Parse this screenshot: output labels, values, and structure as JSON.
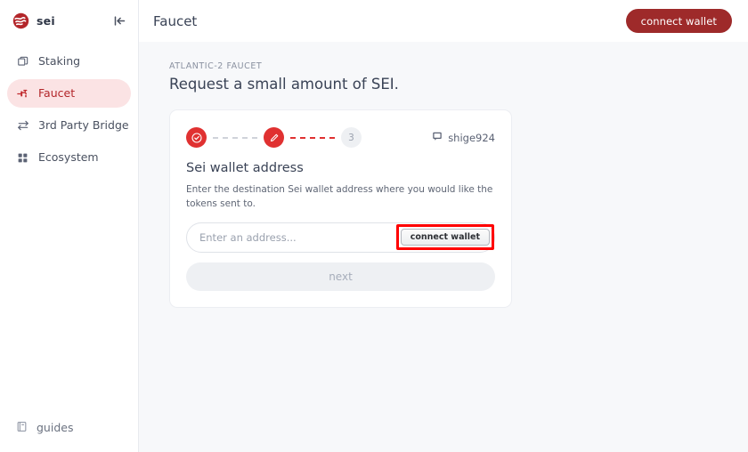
{
  "sidebar": {
    "brand": {
      "name": "sei",
      "logo_icon": "sei-logo-icon"
    },
    "collapse_icon": "collapse-panel-icon",
    "items": [
      {
        "label": "Staking",
        "icon": "layers-icon",
        "active": false
      },
      {
        "label": "Faucet",
        "icon": "faucet-tap-icon",
        "active": true
      },
      {
        "label": "3rd Party Bridge",
        "icon": "bridge-arrows-icon",
        "active": false
      },
      {
        "label": "Ecosystem",
        "icon": "grid-dots-icon",
        "active": false
      }
    ],
    "footer": {
      "label": "guides",
      "icon": "book-icon"
    }
  },
  "header": {
    "title": "Faucet",
    "connect_wallet_label": "connect wallet"
  },
  "main": {
    "eyebrow": "ATLANTIC-2 FAUCET",
    "headline": "Request a small amount of SEI.",
    "card": {
      "stepper": {
        "steps": [
          {
            "state": "done",
            "label": "",
            "icon": "check-circle-icon"
          },
          {
            "state": "active",
            "label": "",
            "icon": "pencil-edit-icon"
          },
          {
            "state": "todo",
            "label": "3",
            "icon": ""
          }
        ],
        "connectors": [
          "gray",
          "red"
        ]
      },
      "user": {
        "name": "shige924",
        "icon": "discord-chat-icon"
      },
      "title": "Sei wallet address",
      "description": "Enter the destination Sei wallet address where you would like the tokens sent to.",
      "address_input": {
        "placeholder": "Enter an address...",
        "value": ""
      },
      "connect_wallet_inline_label": "connect wallet",
      "next_label": "next"
    }
  },
  "colors": {
    "brand_red": "#e03131",
    "dark_red": "#9e2a2a",
    "active_nav_bg": "#fbe3e4",
    "active_nav_text": "#b3262a",
    "page_bg": "#f7f8fa",
    "highlight": "#ff0000"
  }
}
